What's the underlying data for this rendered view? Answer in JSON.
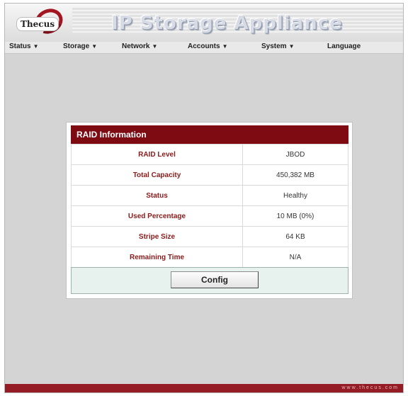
{
  "header": {
    "logo_text": "Thecus",
    "app_title": "IP Storage Appliance"
  },
  "menu": [
    {
      "label": "Status",
      "dropdown": true
    },
    {
      "label": "Storage",
      "dropdown": true
    },
    {
      "label": "Network",
      "dropdown": true
    },
    {
      "label": "Accounts",
      "dropdown": true
    },
    {
      "label": "System",
      "dropdown": true
    },
    {
      "label": "Language",
      "dropdown": false
    }
  ],
  "panel": {
    "title": "RAID Information",
    "rows": [
      {
        "label": "RAID Level",
        "value": "JBOD"
      },
      {
        "label": "Total Capacity",
        "value": "450,382 MB"
      },
      {
        "label": "Status",
        "value": "Healthy"
      },
      {
        "label": "Used Percentage",
        "value": "10 MB (0%)"
      },
      {
        "label": "Stripe Size",
        "value": "64 KB"
      },
      {
        "label": "Remaining Time",
        "value": "N/A"
      }
    ],
    "config_label": "Config"
  },
  "footer": {
    "url_text": "www.thecus.com"
  },
  "colors": {
    "brand_red": "#7e0a12",
    "label_red": "#8b1a1a",
    "config_bg": "#e7f2ef"
  }
}
